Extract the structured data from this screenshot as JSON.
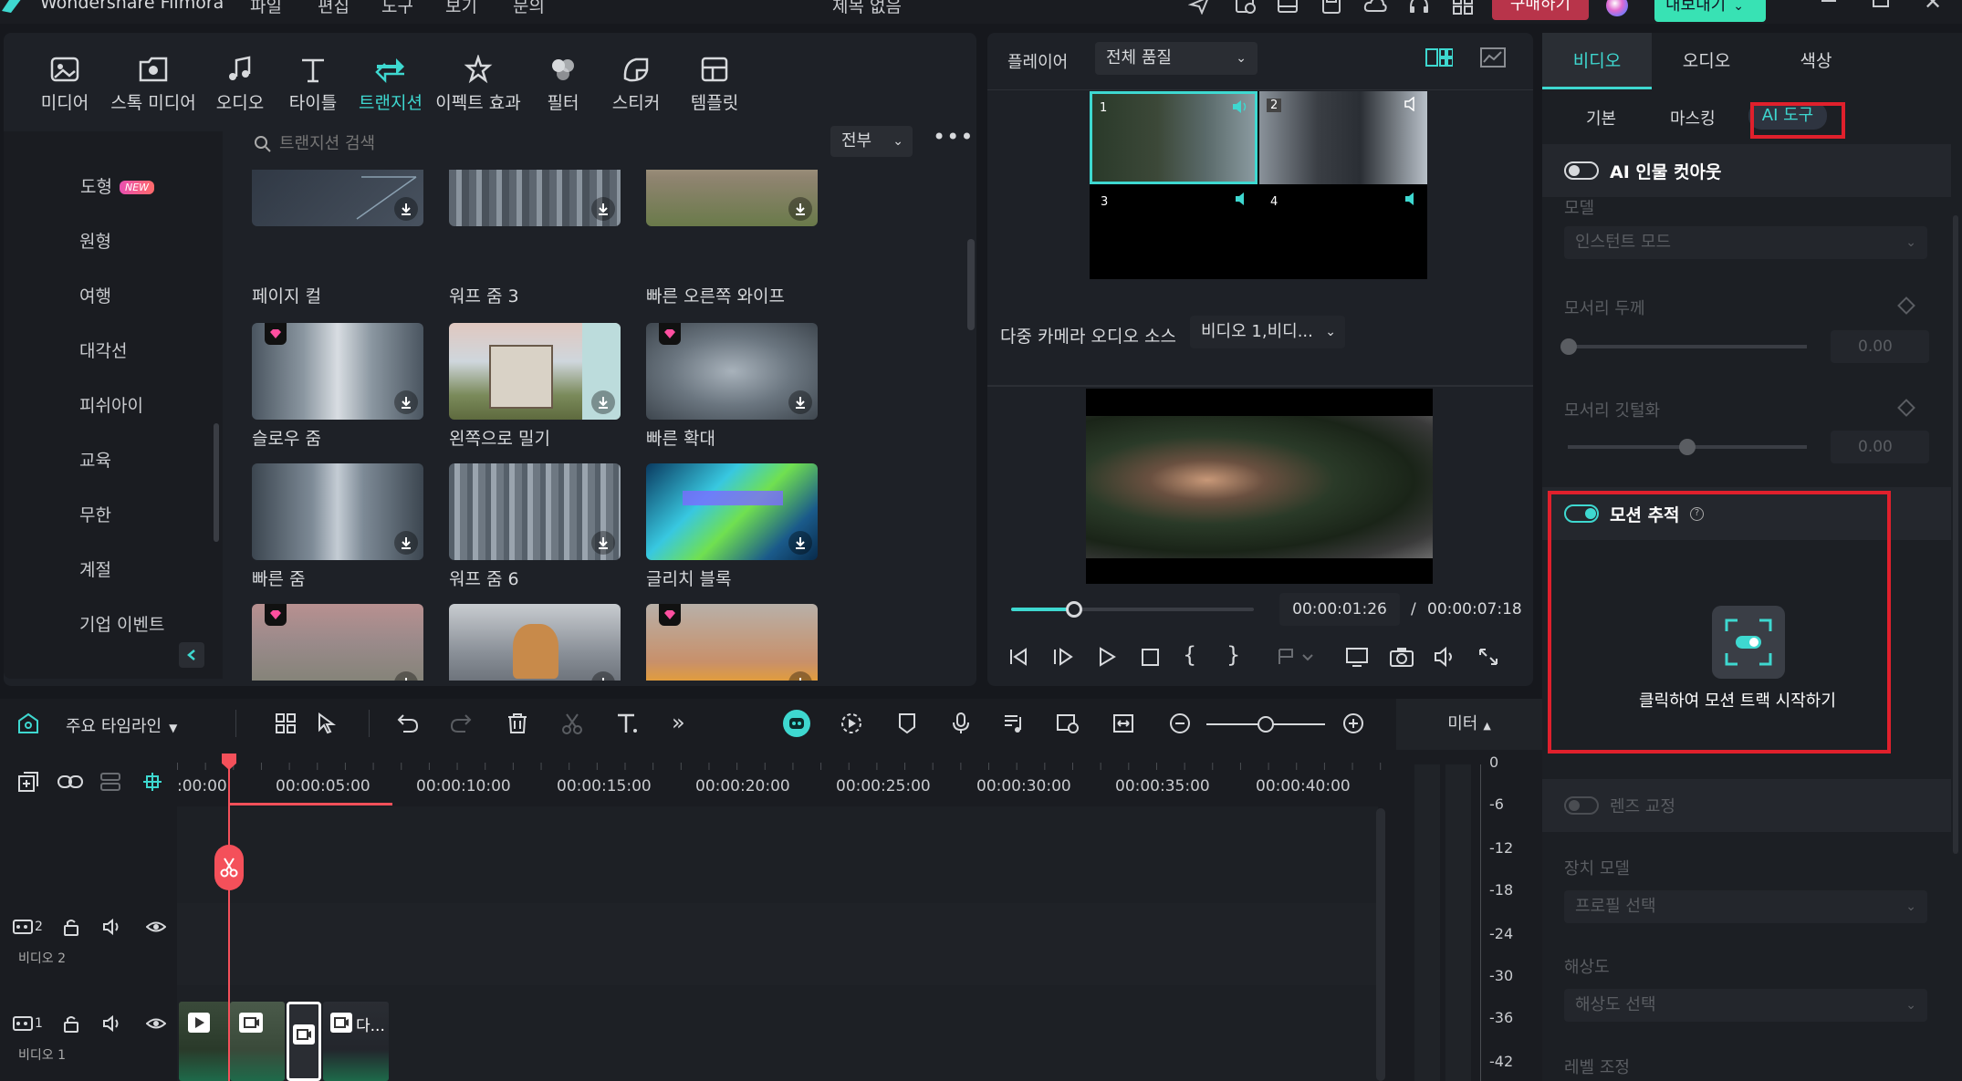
{
  "titlebar": {
    "app_name": "Wondershare Filmora",
    "menus": [
      "파일",
      "편집",
      "도구",
      "보기",
      "문의"
    ],
    "doc_title": "제목 없음",
    "buy_label": "구매하기",
    "export_label": "내보내기"
  },
  "library": {
    "tabs": [
      {
        "label": "미디어",
        "icon": "media-icon"
      },
      {
        "label": "스톡 미디어",
        "icon": "stock-media-icon"
      },
      {
        "label": "오디오",
        "icon": "music-note-icon"
      },
      {
        "label": "타이틀",
        "icon": "text-t-icon"
      },
      {
        "label": "트랜지션",
        "icon": "transition-icon"
      },
      {
        "label": "이펙트 효과",
        "icon": "effects-icon"
      },
      {
        "label": "필터",
        "icon": "filter-icon"
      },
      {
        "label": "스티커",
        "icon": "sticker-icon"
      },
      {
        "label": "템플릿",
        "icon": "template-icon"
      }
    ],
    "active_tab": "트랜지션",
    "categories": [
      "도형",
      "원형",
      "여행",
      "대각선",
      "피쉬아이",
      "교육",
      "무한",
      "계절",
      "기업 이벤트"
    ],
    "new_badge": "NEW",
    "search_placeholder": "트랜지션 검색",
    "filter_value": "전부",
    "items": [
      {
        "label": "페이지 컬"
      },
      {
        "label": "워프 줌 3"
      },
      {
        "label": "빠른 오른쪽 와이프"
      },
      {
        "label": "슬로우 줌"
      },
      {
        "label": "왼쪽으로 밀기"
      },
      {
        "label": "빠른 확대"
      },
      {
        "label": "빠른 줌"
      },
      {
        "label": "워프 줌 6"
      },
      {
        "label": "글리치 블록"
      },
      {
        "label": ""
      },
      {
        "label": ""
      },
      {
        "label": ""
      }
    ]
  },
  "player": {
    "label": "플레이어",
    "quality": "전체 품질",
    "cams": [
      "1",
      "2",
      "3",
      "4"
    ],
    "multicam_audio_label": "다중 카메라 오디오 소스",
    "multicam_audio_value": "비디오 1,비디...",
    "current_time": "00:00:01:26",
    "separator": "/",
    "total_time": "00:00:07:18",
    "progress": 0.26
  },
  "props": {
    "tabs": [
      "비디오",
      "오디오",
      "색상"
    ],
    "subtabs": [
      "기본",
      "마스킹",
      "AI 도구"
    ],
    "ai_cutout_label": "AI 인물 컷아웃",
    "model_label": "모델",
    "model_value": "인스턴트 모드",
    "edge_thickness_label": "모서리 두께",
    "edge_thickness_value": "0.00",
    "edge_feather_label": "모서리 깃털화",
    "edge_feather_value": "0.00",
    "motion_tracking_label": "모션 추적",
    "motion_track_start_label": "클릭하여 모션 트랙 시작하기",
    "lens_correction_label": "렌즈 교정",
    "device_model_label": "장치 모델",
    "device_model_value": "프로필 선택",
    "resolution_label": "해상도",
    "resolution_value": "해상도 선택",
    "level_label": "레벨 조정"
  },
  "timeline": {
    "name": "주요 타임라인",
    "meter_label": "미터",
    "ticks": [
      ":00:00",
      "00:00:05:00",
      "00:00:10:00",
      "00:00:15:00",
      "00:00:20:00",
      "00:00:25:00",
      "00:00:30:00",
      "00:00:35:00",
      "00:00:40:00"
    ],
    "meter_scale": [
      "0",
      "-6",
      "-12",
      "-18",
      "-24",
      "-30",
      "-36",
      "-42"
    ],
    "tracks": [
      {
        "num": "2",
        "name": "비디오 2"
      },
      {
        "num": "1",
        "name": "비디오 1"
      }
    ],
    "clip_text": "다..."
  },
  "colors": {
    "accent": "#3ed8d0",
    "highlight_red": "#e0202c",
    "playhead": "#f4505a",
    "export_green": "#38e2b4",
    "buy_red": "#b8344a"
  }
}
